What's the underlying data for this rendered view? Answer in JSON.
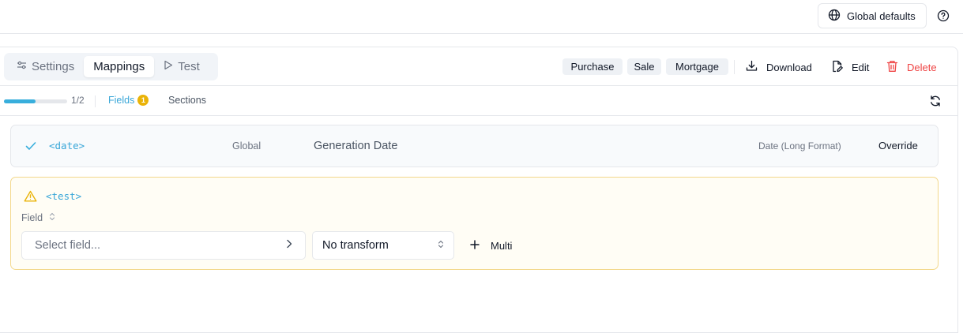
{
  "topbar": {
    "global_defaults_label": "Global defaults",
    "globe_icon": "globe-icon",
    "help_icon": "help-circle-icon"
  },
  "tabs": [
    {
      "label": "Settings",
      "icon": "sliders-icon",
      "active": false
    },
    {
      "label": "Mappings",
      "icon": "",
      "active": true
    },
    {
      "label": "Test",
      "icon": "play-icon",
      "active": false
    }
  ],
  "filters": [
    "Purchase",
    "Sale",
    "Mortgage"
  ],
  "actions": {
    "download": "Download",
    "edit": "Edit",
    "delete": "Delete"
  },
  "subbar": {
    "progress_fraction": 0.5,
    "progress_text": "1/2",
    "fields_label": "Fields",
    "fields_badge": "1",
    "sections_label": "Sections"
  },
  "mappings": [
    {
      "tag": "<date>",
      "scope": "Global",
      "field": "Generation Date",
      "transform": "Date (Long Format)",
      "action": "Override",
      "status": "ok"
    },
    {
      "tag": "<test>",
      "status": "warning",
      "field_label": "Field",
      "select_placeholder": "Select field...",
      "transform_value": "No transform",
      "multi_label": "Multi"
    }
  ],
  "colors": {
    "accent": "#38aedc",
    "warning": "#eab308",
    "danger": "#ef4444",
    "warning_border": "#f3d88b"
  }
}
